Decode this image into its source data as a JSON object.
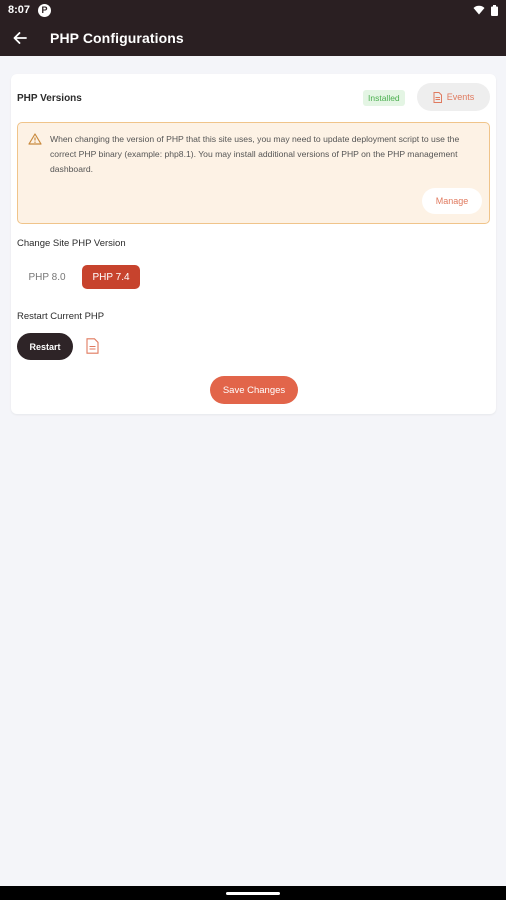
{
  "status_bar": {
    "time": "8:07",
    "app_badge": "P"
  },
  "app_bar": {
    "title": "PHP Configurations"
  },
  "php_versions": {
    "title": "PHP Versions",
    "installed_label": "Installed",
    "events_label": "Events",
    "notice": "When changing the version of PHP that this site uses, you may need to update deployment script to use the correct PHP binary (example: php8.1). You may install additional versions of PHP on the PHP management dashboard.",
    "manage_label": "Manage"
  },
  "change_version": {
    "title": "Change Site PHP Version",
    "options": [
      "PHP 8.0",
      "PHP 7.4"
    ],
    "selected": "PHP 7.4"
  },
  "restart": {
    "title": "Restart Current PHP",
    "button_label": "Restart"
  },
  "save_label": "Save Changes",
  "colors": {
    "header_bg": "#2a1f22",
    "accent": "#e2654a",
    "selected": "#c7432d",
    "notice_bg": "#fdf2e5",
    "notice_border": "#f0c48a",
    "installed_green": "#4caf50"
  }
}
